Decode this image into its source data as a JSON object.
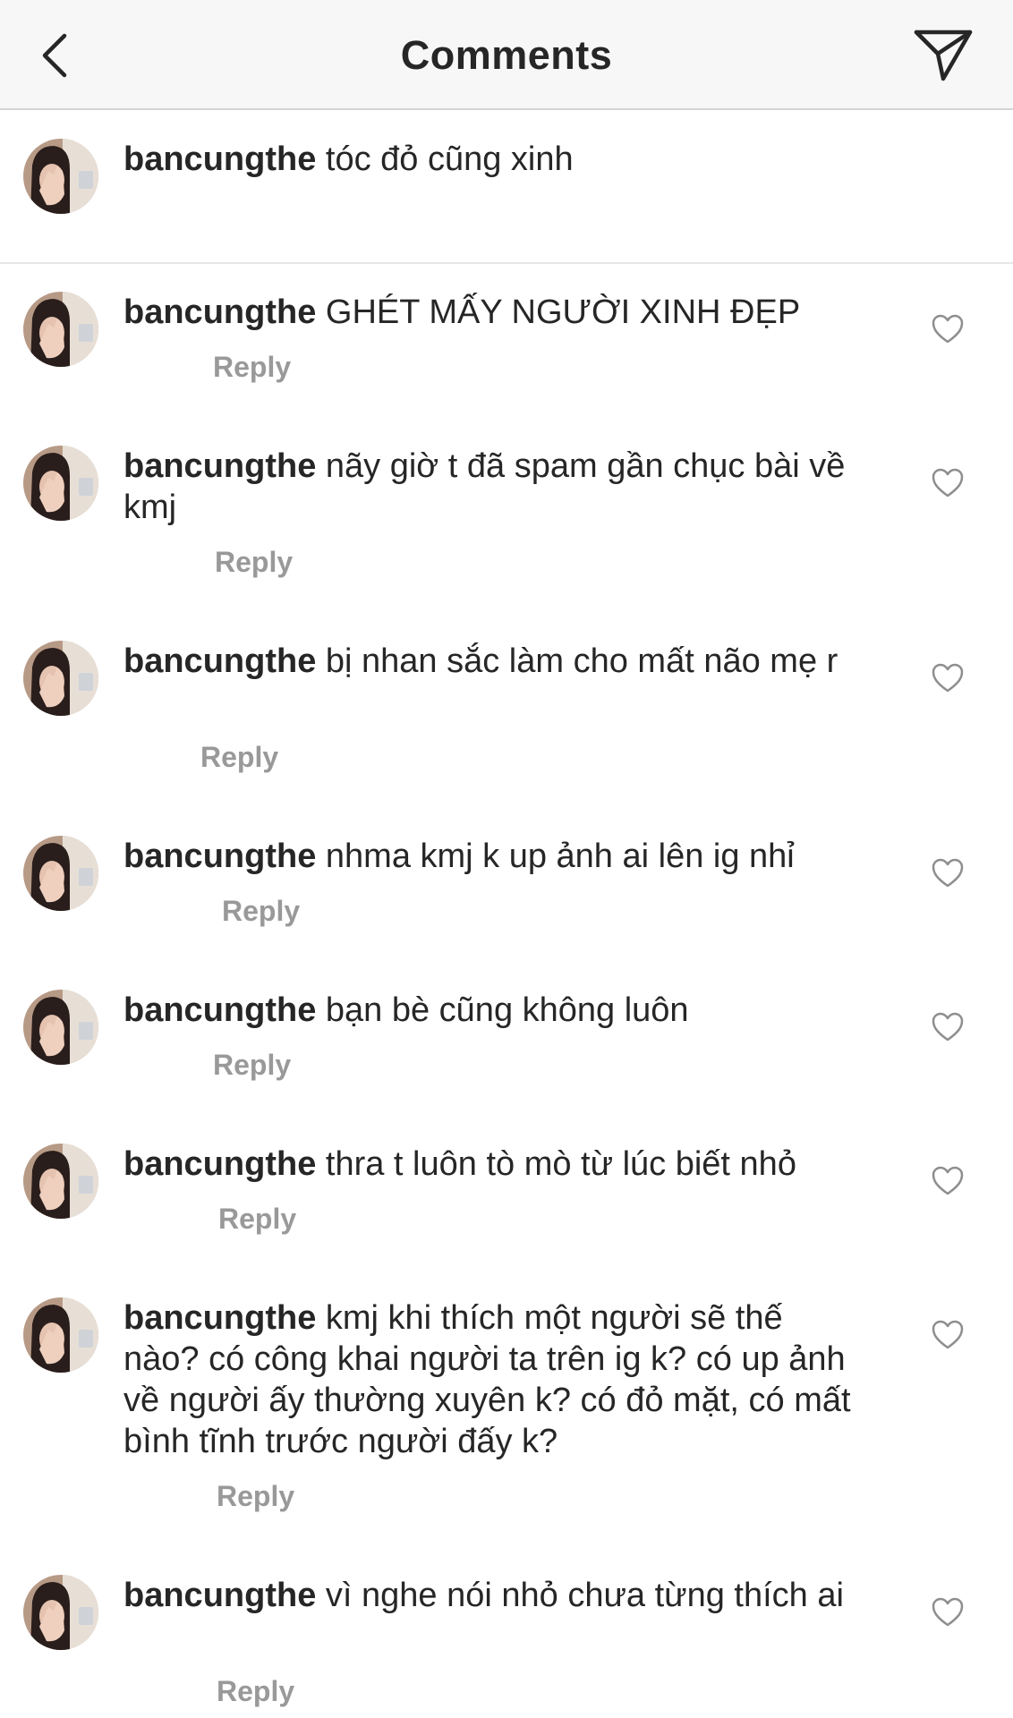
{
  "header": {
    "title": "Comments",
    "back_icon": "chevron-left-icon",
    "send_icon": "paper-plane-icon"
  },
  "caption": {
    "username": "bancungthe",
    "text": "tóc đỏ cũng xinh"
  },
  "comments": [
    {
      "username": "bancungthe",
      "text": "GHÉT MẤY NGƯỜI XINH ĐẸP",
      "reply": "Reply"
    },
    {
      "username": "bancungthe",
      "text": "nãy giờ t đã spam gần chục bài về kmj",
      "reply": "Reply"
    },
    {
      "username": "bancungthe",
      "text": "bị nhan sắc làm cho mất não mẹ r",
      "reply": "Reply"
    },
    {
      "username": "bancungthe",
      "text": "nhma kmj k up ảnh ai lên ig nhỉ",
      "reply": "Reply"
    },
    {
      "username": "bancungthe",
      "text": "bạn bè cũng không luôn",
      "reply": "Reply"
    },
    {
      "username": "bancungthe",
      "text": "thra t luôn tò mò từ lúc biết nhỏ",
      "reply": "Reply"
    },
    {
      "username": "bancungthe",
      "text": "kmj khi thích một người sẽ thế nào? có công khai người ta trên ig k? có up ảnh về người ấy thường xuyên k? có đỏ mặt, có mất bình tĩnh trước người đấy k?",
      "reply": "Reply"
    },
    {
      "username": "bancungthe",
      "text": "vì nghe nói nhỏ chưa từng thích ai",
      "reply": "Reply"
    }
  ],
  "colors": {
    "header_bg": "#f7f7f7",
    "text": "#262626",
    "reply": "#999999",
    "divider": "#e6e6e6",
    "icon": "#262626"
  }
}
